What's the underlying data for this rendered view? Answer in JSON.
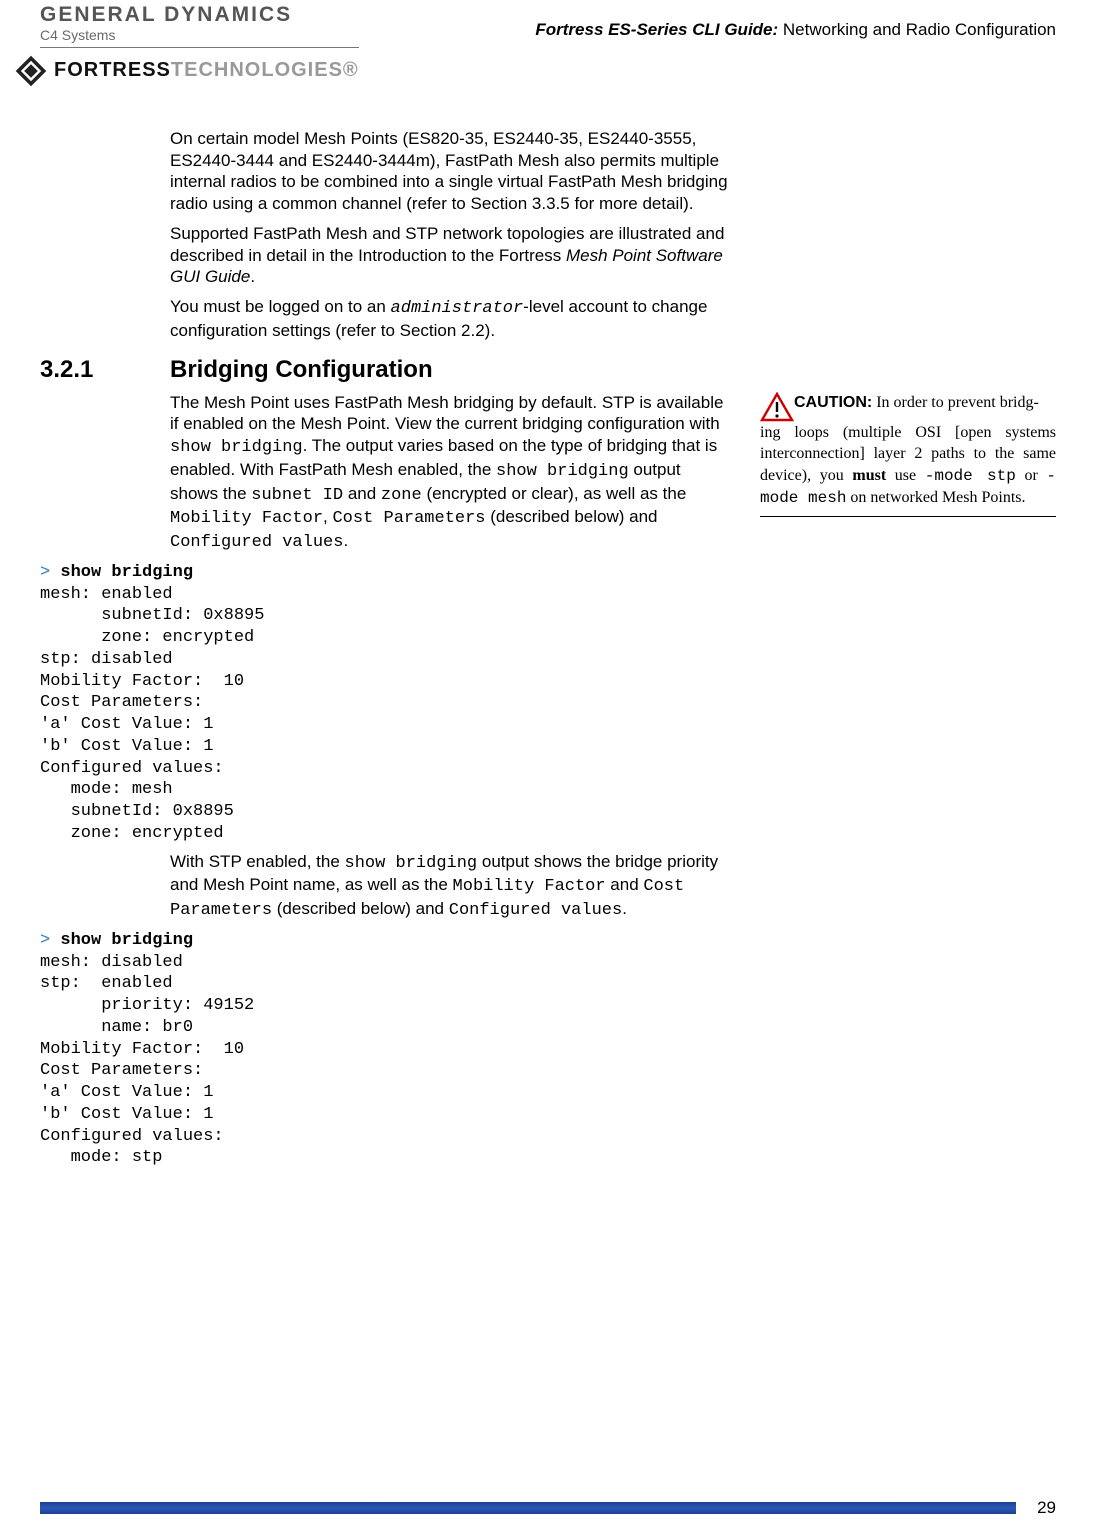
{
  "header": {
    "brand_main": "GENERAL DYNAMICS",
    "brand_sub": "C4 Systems",
    "fortress_bold": "FORTRESS",
    "fortress_light": "TECHNOLOGIES®",
    "doc_title_bi": "Fortress ES-Series CLI Guide:",
    "doc_title_rest": " Networking and Radio Configuration"
  },
  "intro": {
    "p1": "On certain model Mesh Points (ES820-35, ES2440-35, ES2440-3555, ES2440-3444 and ES2440-3444m), FastPath Mesh also permits multiple internal radios to be combined into a single virtual FastPath Mesh bridging radio using a common channel (refer to Section 3.3.5 for more detail).",
    "p2_a": "Supported FastPath Mesh and STP network topologies are illustrated and described in detail in the Introduction to the Fortress ",
    "p2_i": "Mesh Point Software GUI Guide",
    "p2_b": ".",
    "p3_a": "You must be logged on to an ",
    "p3_m": "administrator",
    "p3_b": "-level account to change configuration settings (refer to Section 2.2)."
  },
  "section": {
    "num": "3.2.1",
    "title": "Bridging Configuration",
    "p1_a": "The Mesh Point uses FastPath Mesh bridging by default. STP is available if enabled on the Mesh Point. View the current bridging configuration with ",
    "p1_m1": "show bridging",
    "p1_b": ". The output varies based on the type of bridging that is enabled. With FastPath Mesh enabled, the ",
    "p1_m2": "show bridging",
    "p1_c": " output shows the ",
    "p1_m3": "subnet ID",
    "p1_d": " and ",
    "p1_m4": "zone",
    "p1_e": " (encrypted or clear), as well as the ",
    "p1_m5": "Mobility Factor",
    "p1_f": ", ",
    "p1_m6": "Cost Parameters",
    "p1_g": " (described below) and ",
    "p1_m7": "Configured values",
    "p1_h": "."
  },
  "cli1": {
    "prompt": "> ",
    "cmd": "show bridging",
    "body": "mesh: enabled\n      subnetId: 0x8895\n      zone: encrypted\nstp: disabled\nMobility Factor:  10\nCost Parameters:\n'a' Cost Value: 1\n'b' Cost Value: 1\nConfigured values:\n   mode: mesh\n   subnetId: 0x8895\n   zone: encrypted"
  },
  "mid": {
    "p_a": "With STP enabled, the ",
    "p_m1": "show bridging",
    "p_b": " output shows the bridge priority and Mesh Point name, as well as the ",
    "p_m2": "Mobility Factor",
    "p_c": " and ",
    "p_m3": "Cost Parameters",
    "p_d": " (described below) and ",
    "p_m4": "Configured values",
    "p_e": "."
  },
  "cli2": {
    "prompt": "> ",
    "cmd": "show bridging",
    "body": "mesh: disabled\nstp:  enabled\n      priority: 49152\n      name: br0\nMobility Factor:  10\nCost Parameters:\n'a' Cost Value: 1\n'b' Cost Value: 1\nConfigured values:\n   mode: stp"
  },
  "caution": {
    "lead": "CAUTION:",
    "t1": " In order to prevent bridg-",
    "t2": "ing loops (multiple OSI [open systems intercon­nection] layer 2 paths to the same device), you ",
    "must": "must",
    "t3": " use ",
    "m1": "-mode stp",
    "t4": " or ",
    "m2": "-mode  mesh",
    "t5": " on net­worked Mesh Points."
  },
  "page_number": "29"
}
